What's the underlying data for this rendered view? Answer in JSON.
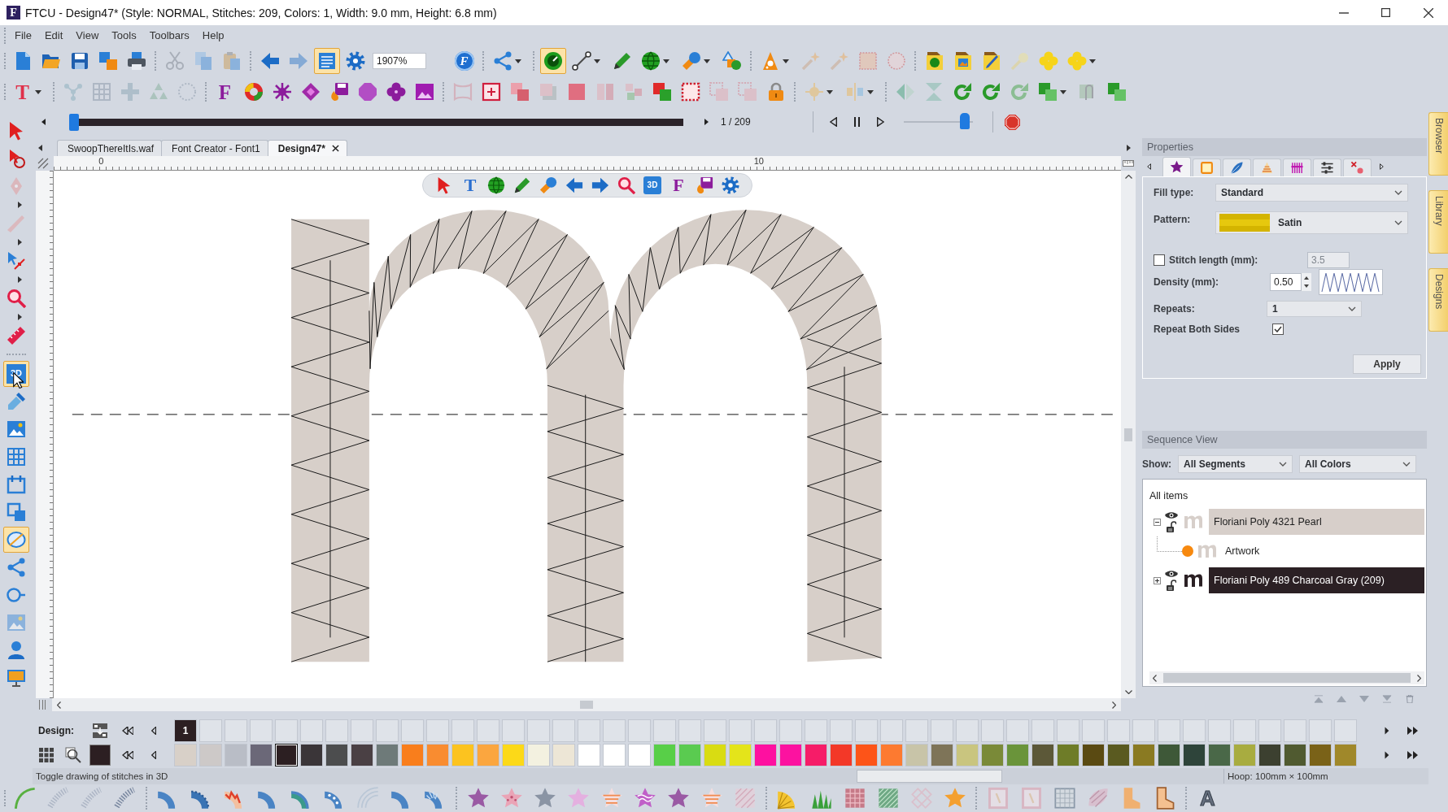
{
  "window": {
    "logo": "F",
    "title": "FTCU - Design47* (Style: NORMAL, Stitches: 209, Colors: 1, Width: 9.0 mm, Height: 6.8 mm)"
  },
  "menu": [
    "File",
    "Edit",
    "View",
    "Tools",
    "Toolbars",
    "Help"
  ],
  "toolbar_1": [
    [
      {
        "kind": "new",
        "on": false,
        "disabled": false
      },
      {
        "kind": "open",
        "on": false,
        "disabled": false
      },
      {
        "kind": "save",
        "on": false,
        "disabled": false
      },
      {
        "kind": "save_all",
        "on": false,
        "disabled": false
      },
      {
        "kind": "print",
        "on": false,
        "disabled": false
      }
    ],
    [
      {
        "kind": "cut",
        "on": false,
        "disabled": true
      },
      {
        "kind": "copy",
        "on": false,
        "disabled": true
      },
      {
        "kind": "paste",
        "on": false,
        "disabled": true
      }
    ],
    [
      {
        "kind": "back",
        "on": false,
        "disabled": false
      },
      {
        "kind": "forward",
        "on": false,
        "disabled": true
      },
      {
        "kind": "list",
        "on": true,
        "disabled": false
      },
      {
        "kind": "gear",
        "on": false,
        "disabled": false
      },
      {
        "kind": "field",
        "value": "1907%",
        "on": false,
        "disabled": false
      },
      {
        "kind": "font_circle",
        "text": "F",
        "on": false,
        "disabled": false
      }
    ],
    [
      {
        "kind": "share",
        "on": false,
        "disabled": false
      },
      {
        "kind": "caret",
        "on": false,
        "disabled": false
      }
    ],
    [
      {
        "kind": "gauge",
        "on": true,
        "disabled": false
      },
      {
        "kind": "line",
        "on": false,
        "disabled": false
      },
      {
        "kind": "caret",
        "on": false,
        "disabled": false
      },
      {
        "kind": "pencil",
        "on": false,
        "disabled": false
      },
      {
        "kind": "globe",
        "on": false,
        "disabled": false
      },
      {
        "kind": "caret",
        "on": false,
        "disabled": false
      },
      {
        "kind": "shape_tool",
        "on": false,
        "disabled": false
      },
      {
        "kind": "caret",
        "on": false,
        "disabled": false
      },
      {
        "kind": "shapes",
        "on": false,
        "disabled": false
      }
    ],
    [
      {
        "kind": "cone",
        "on": false,
        "disabled": false
      },
      {
        "kind": "caret",
        "on": false,
        "disabled": false
      },
      {
        "kind": "wand",
        "on": false,
        "disabled": true
      },
      {
        "kind": "wand",
        "on": false,
        "disabled": true
      },
      {
        "kind": "dotted_square",
        "on": false,
        "disabled": true
      },
      {
        "kind": "dotted_circle",
        "on": false,
        "disabled": true
      }
    ],
    [
      {
        "kind": "folder_green",
        "on": false,
        "disabled": false
      },
      {
        "kind": "folder_picture",
        "on": false,
        "disabled": false
      },
      {
        "kind": "folder_brush",
        "on": false,
        "disabled": false
      },
      {
        "kind": "yellow_wand",
        "on": false,
        "disabled": true
      },
      {
        "kind": "clover",
        "on": false,
        "disabled": false
      },
      {
        "kind": "clover",
        "on": false,
        "disabled": false
      },
      {
        "kind": "caret",
        "on": false,
        "disabled": false
      }
    ]
  ],
  "toolbar_2": [
    [
      {
        "kind": "text_tool",
        "text": "T",
        "on": false,
        "disabled": false
      },
      {
        "kind": "caret",
        "on": false,
        "disabled": false
      }
    ],
    [
      {
        "kind": "nodes",
        "on": false,
        "disabled": true
      },
      {
        "kind": "grid",
        "on": false,
        "disabled": true
      },
      {
        "kind": "cross",
        "on": false,
        "disabled": true
      },
      {
        "kind": "triangles",
        "on": false,
        "disabled": true
      },
      {
        "kind": "dotted_ring",
        "on": false,
        "disabled": true
      }
    ],
    [
      {
        "kind": "font",
        "text": "F",
        "on": false,
        "disabled": false
      },
      {
        "kind": "color_wheel",
        "on": false,
        "disabled": false
      },
      {
        "kind": "burst",
        "on": false,
        "disabled": false
      },
      {
        "kind": "diamonds",
        "on": false,
        "disabled": false
      },
      {
        "kind": "save_flame",
        "on": false,
        "disabled": false
      },
      {
        "kind": "octagon",
        "on": false,
        "disabled": false
      },
      {
        "kind": "purple_clover",
        "on": false,
        "disabled": false
      },
      {
        "kind": "picture",
        "on": false,
        "disabled": false
      }
    ],
    [
      {
        "kind": "pink_frame",
        "on": false,
        "disabled": true
      },
      {
        "kind": "crop_frame",
        "on": false,
        "disabled": false
      },
      {
        "kind": "pink_squares",
        "on": false,
        "disabled": false
      },
      {
        "kind": "shadow_square",
        "on": false,
        "disabled": true
      },
      {
        "kind": "pink_square",
        "on": false,
        "disabled": false
      },
      {
        "kind": "split_square",
        "on": false,
        "disabled": true
      },
      {
        "kind": "mosaic",
        "on": false,
        "disabled": true
      },
      {
        "kind": "overlap",
        "on": false,
        "disabled": false
      },
      {
        "kind": "dotted_frame",
        "on": false,
        "disabled": false
      },
      {
        "kind": "stacked_squares",
        "on": false,
        "disabled": true
      },
      {
        "kind": "stacked_squares",
        "on": false,
        "disabled": true
      },
      {
        "kind": "lock",
        "on": false,
        "disabled": false
      }
    ],
    [
      {
        "kind": "sun",
        "on": false,
        "disabled": true
      },
      {
        "kind": "caret",
        "on": false,
        "disabled": false
      },
      {
        "kind": "align",
        "on": false,
        "disabled": true
      },
      {
        "kind": "caret",
        "on": false,
        "disabled": false
      }
    ],
    [
      {
        "kind": "mirror",
        "on": false,
        "disabled": true
      },
      {
        "kind": "flip",
        "on": false,
        "disabled": true
      },
      {
        "kind": "rotate",
        "on": false,
        "disabled": false
      },
      {
        "kind": "rotate",
        "on": false,
        "disabled": false
      },
      {
        "kind": "rotate",
        "on": false,
        "disabled": true
      },
      {
        "kind": "green_squares",
        "on": false,
        "disabled": false
      },
      {
        "kind": "caret",
        "on": false,
        "disabled": false
      },
      {
        "kind": "clip",
        "on": false,
        "disabled": true
      },
      {
        "kind": "green_squares",
        "on": false,
        "disabled": false
      }
    ]
  ],
  "playback": {
    "level": 0,
    "reading": "1 / 209",
    "speed": {
      "level": 0.95
    }
  },
  "left_toolbar": [
    [
      {
        "kind": "select",
        "on": false,
        "disabled": false
      },
      {
        "kind": "reshape",
        "on": false,
        "disabled": false
      },
      {
        "kind": "pen",
        "on": false,
        "disabled": true
      },
      {
        "kind": "caret",
        "on": false,
        "disabled": false
      },
      {
        "kind": "knife",
        "on": false,
        "disabled": true
      },
      {
        "kind": "caret",
        "on": false,
        "disabled": false
      },
      {
        "kind": "node",
        "on": false,
        "disabled": false
      },
      {
        "kind": "caret",
        "on": false,
        "disabled": false
      },
      {
        "kind": "zoom_tool",
        "on": false,
        "disabled": false
      },
      {
        "kind": "caret",
        "on": false,
        "disabled": false
      },
      {
        "kind": "ruler",
        "on": false,
        "disabled": false
      }
    ],
    [
      {
        "kind": "view_3d",
        "text": "3D",
        "on": true,
        "disabled": false
      },
      {
        "kind": "dropper",
        "on": false,
        "disabled": false
      },
      {
        "kind": "image",
        "on": false,
        "disabled": false
      },
      {
        "kind": "blue_grid",
        "on": false,
        "disabled": false
      },
      {
        "kind": "blue_frame",
        "on": false,
        "disabled": false
      },
      {
        "kind": "blue_frame2",
        "on": false,
        "disabled": false
      },
      {
        "kind": "hoop",
        "on": true,
        "disabled": false
      },
      {
        "kind": "share",
        "on": false,
        "disabled": false
      },
      {
        "kind": "blue_circle",
        "on": false,
        "disabled": false
      },
      {
        "kind": "image",
        "on": false,
        "disabled": true
      },
      {
        "kind": "user",
        "on": false,
        "disabled": false
      },
      {
        "kind": "monitor",
        "on": false,
        "disabled": false
      }
    ]
  ],
  "tabs": [
    {
      "label": "SwoopThereItIs.waf",
      "selected": false
    },
    {
      "label": "Font Creator - Font1",
      "selected": false
    },
    {
      "label": "Design47*",
      "selected": true
    }
  ],
  "ruler": {
    "labels": [
      "0",
      "10"
    ]
  },
  "floating_toolbar": [
    [
      {
        "kind": "select",
        "on": false,
        "disabled": false
      },
      {
        "kind": "text_tool_blue",
        "text": "T",
        "on": false,
        "disabled": false
      },
      {
        "kind": "globe",
        "on": false,
        "disabled": false
      },
      {
        "kind": "pencil",
        "on": false,
        "disabled": false
      },
      {
        "kind": "shape_tool",
        "on": false,
        "disabled": false
      },
      {
        "kind": "back",
        "on": false,
        "disabled": false
      },
      {
        "kind": "forward",
        "on": false,
        "disabled": false
      },
      {
        "kind": "search",
        "on": false,
        "disabled": false
      },
      {
        "kind": "view_3d",
        "text": "3D",
        "on": false,
        "disabled": false
      },
      {
        "kind": "font",
        "text": "F",
        "on": false,
        "disabled": false
      },
      {
        "kind": "save_flame",
        "on": false,
        "disabled": false
      },
      {
        "kind": "gear",
        "on": false,
        "disabled": false
      }
    ]
  ],
  "properties": {
    "title": "Properties",
    "tabs": [
      {
        "kind": "tab_star",
        "selected": true
      },
      {
        "kind": "tab_square",
        "selected": false
      },
      {
        "kind": "tab_feather",
        "selected": false
      },
      {
        "kind": "tab_hat",
        "selected": false
      },
      {
        "kind": "tab_comb",
        "selected": false
      },
      {
        "kind": "tab_sliders",
        "selected": false
      },
      {
        "kind": "tab_remove",
        "selected": false
      }
    ],
    "fill_type": {
      "label": "Fill type:",
      "value": "Standard"
    },
    "pattern": {
      "label": "Pattern:",
      "value": "Satin"
    },
    "stitch_length": {
      "label": "Stitch length (mm):",
      "checked": false,
      "value": "3.5"
    },
    "density": {
      "label": "Density (mm):",
      "value": "0.50"
    },
    "repeats": {
      "label": "Repeats:",
      "value": "1"
    },
    "repeat_both_sides": {
      "label": "Repeat Both Sides",
      "checked": true
    },
    "apply": "Apply"
  },
  "sequence": {
    "title": "Sequence View",
    "show_label": "Show:",
    "segment_filter": "All Segments",
    "color_filter": "All Colors",
    "root": "All items",
    "items": [
      {
        "label": "Floriani Poly 4321 Pearl",
        "color": "#d7cfca",
        "expanded": true,
        "visible": true,
        "locked": false,
        "children": [
          {
            "label": "Artwork"
          }
        ]
      },
      {
        "label": "Floriani Poly 489 Charcoal Gray (209)",
        "color": "#2b2024",
        "expanded": false,
        "visible": true,
        "locked": false
      }
    ]
  },
  "side_tabs": [
    "Browser",
    "Library",
    "Designs"
  ],
  "palette": {
    "label": "Design:",
    "design_colors": [
      {
        "number": "1",
        "color": "#2c1f22"
      }
    ],
    "current_swatch": {
      "color": "#2c1f22"
    },
    "colors": [
      {
        "color": "#d8d0c8",
        "selected": false
      },
      {
        "color": "#cdc9c8",
        "selected": false
      },
      {
        "color": "#b9bdc6",
        "selected": false
      },
      {
        "color": "#6b6878",
        "selected": false
      },
      {
        "color": "#2c1f22",
        "selected": true
      },
      {
        "color": "#3a3538",
        "selected": false
      },
      {
        "color": "#4c4d4e",
        "selected": false
      },
      {
        "color": "#4a4044",
        "selected": false
      },
      {
        "color": "#6e7a79",
        "selected": false
      },
      {
        "color": "#f97e1c",
        "selected": false
      },
      {
        "color": "#f98c30",
        "selected": false
      },
      {
        "color": "#fcc31f",
        "selected": false
      },
      {
        "color": "#fba63f",
        "selected": false
      },
      {
        "color": "#fcd918",
        "selected": false
      },
      {
        "color": "#f3f1e0",
        "selected": false
      },
      {
        "color": "#ede6d6",
        "selected": false
      },
      {
        "color": "#ffffff",
        "selected": false
      },
      {
        "color": "#ffffff",
        "selected": false
      },
      {
        "color": "#ffffff",
        "selected": false
      },
      {
        "color": "#58cf48",
        "selected": false
      },
      {
        "color": "#5acb50",
        "selected": false
      },
      {
        "color": "#d9dc12",
        "selected": false
      },
      {
        "color": "#e4e41a",
        "selected": false
      },
      {
        "color": "#fe10a0",
        "selected": false
      },
      {
        "color": "#fc12a0",
        "selected": false
      },
      {
        "color": "#f61c68",
        "selected": false
      },
      {
        "color": "#f33828",
        "selected": false
      },
      {
        "color": "#fd5418",
        "selected": false
      },
      {
        "color": "#fd7a30",
        "selected": false
      },
      {
        "color": "#c8c4a8",
        "selected": false
      },
      {
        "color": "#7e7458",
        "selected": false
      },
      {
        "color": "#c9c57f",
        "selected": false
      },
      {
        "color": "#7a8a38",
        "selected": false
      },
      {
        "color": "#6a943a",
        "selected": false
      },
      {
        "color": "#5c5838",
        "selected": false
      },
      {
        "color": "#6e7c28",
        "selected": false
      },
      {
        "color": "#5a4a12",
        "selected": false
      },
      {
        "color": "#5a5a20",
        "selected": false
      },
      {
        "color": "#8a7a22",
        "selected": false
      },
      {
        "color": "#3e5838",
        "selected": false
      },
      {
        "color": "#2e443a",
        "selected": false
      },
      {
        "color": "#4a6848",
        "selected": false
      },
      {
        "color": "#a8ac40",
        "selected": false
      },
      {
        "color": "#3c4030",
        "selected": false
      },
      {
        "color": "#505a30",
        "selected": false
      },
      {
        "color": "#7a6218",
        "selected": false
      },
      {
        "color": "#a0882a",
        "selected": false
      }
    ]
  },
  "status": {
    "hint": "Toggle drawing of stitches in 3D",
    "hoop": "Hoop: 100mm × 100mm"
  },
  "bottom_toolbar": [
    [
      {
        "kind": "arc",
        "on": false,
        "disabled": false
      },
      {
        "kind": "feather",
        "on": false,
        "disabled": true
      },
      {
        "kind": "feather",
        "on": false,
        "disabled": true
      },
      {
        "kind": "feather",
        "on": false,
        "disabled": false
      }
    ],
    [
      {
        "kind": "fan",
        "on": false,
        "disabled": false
      },
      {
        "kind": "fan_notched",
        "on": false,
        "disabled": false
      },
      {
        "kind": "fan_zigzag",
        "on": false,
        "disabled": false
      },
      {
        "kind": "fan",
        "on": false,
        "disabled": false
      },
      {
        "kind": "fan_green",
        "on": false,
        "disabled": false
      },
      {
        "kind": "fan_dotted",
        "on": false,
        "disabled": false
      },
      {
        "kind": "arcs",
        "on": false,
        "disabled": true
      },
      {
        "kind": "fan",
        "on": false,
        "disabled": false
      },
      {
        "kind": "fan_lines",
        "on": false,
        "disabled": false
      }
    ],
    [
      {
        "kind": "star_purple",
        "on": false,
        "disabled": false
      },
      {
        "kind": "star_pink",
        "on": false,
        "disabled": false
      },
      {
        "kind": "star_gray",
        "on": false,
        "disabled": false
      },
      {
        "kind": "star_light",
        "on": false,
        "disabled": false
      },
      {
        "kind": "star_striped",
        "on": false,
        "disabled": false
      },
      {
        "kind": "star_wave",
        "on": false,
        "disabled": false
      },
      {
        "kind": "star_purple",
        "on": false,
        "disabled": false
      },
      {
        "kind": "star_striped",
        "on": false,
        "disabled": false
      },
      {
        "kind": "hatch",
        "on": false,
        "disabled": true
      }
    ],
    [
      {
        "kind": "yellow_fan",
        "on": false,
        "disabled": false
      },
      {
        "kind": "grass",
        "on": false,
        "disabled": false
      },
      {
        "kind": "pink_pattern",
        "on": false,
        "disabled": false
      },
      {
        "kind": "green_pattern",
        "on": false,
        "disabled": false
      },
      {
        "kind": "lattice",
        "on": false,
        "disabled": true
      },
      {
        "kind": "orange_star",
        "on": false,
        "disabled": false
      }
    ],
    [
      {
        "kind": "pink_frame2",
        "on": false,
        "disabled": true
      },
      {
        "kind": "pink_frame2",
        "on": false,
        "disabled": true
      },
      {
        "kind": "grid_pattern",
        "on": false,
        "disabled": false
      },
      {
        "kind": "striped_leaf",
        "on": false,
        "disabled": true
      },
      {
        "kind": "boot",
        "on": false,
        "disabled": false
      },
      {
        "kind": "boot2",
        "on": false,
        "disabled": false
      }
    ],
    [
      {
        "kind": "outline_text",
        "text": "A",
        "on": false,
        "disabled": false
      }
    ]
  ]
}
